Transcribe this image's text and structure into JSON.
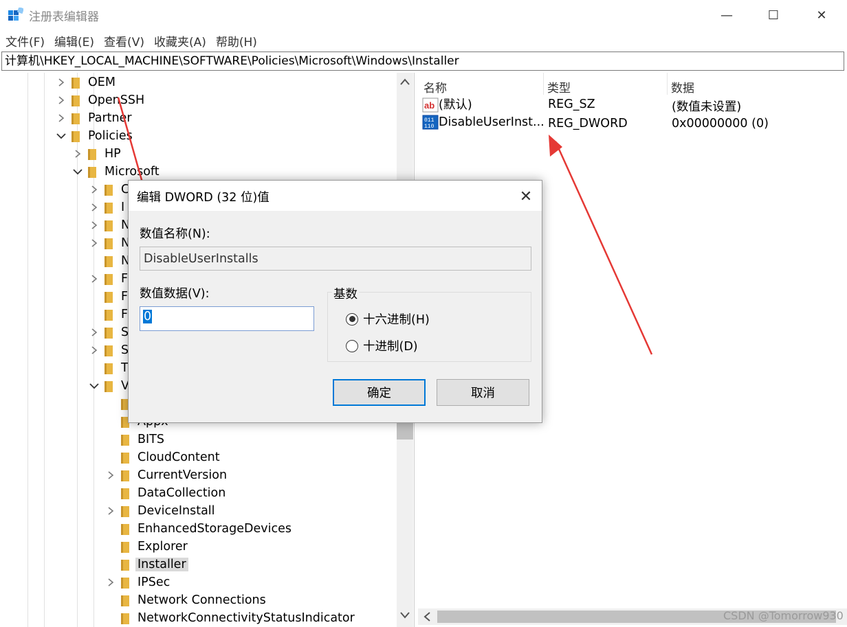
{
  "window": {
    "title": "注册表编辑器",
    "minimize_glyph": "—",
    "maximize_glyph": "☐",
    "close_glyph": "✕"
  },
  "menu": [
    "文件(F)",
    "编辑(E)",
    "查看(V)",
    "收藏夹(A)",
    "帮助(H)"
  ],
  "address": "计算机\\HKEY_LOCAL_MACHINE\\SOFTWARE\\Policies\\Microsoft\\Windows\\Installer",
  "tree": [
    {
      "label": "OEM",
      "depth": 0,
      "expander": "collapsed"
    },
    {
      "label": "OpenSSH",
      "depth": 0,
      "expander": "collapsed"
    },
    {
      "label": "Partner",
      "depth": 0,
      "expander": "collapsed"
    },
    {
      "label": "Policies",
      "depth": 0,
      "expander": "expanded"
    },
    {
      "label": "HP",
      "depth": 1,
      "expander": "collapsed"
    },
    {
      "label": "Microsoft",
      "depth": 1,
      "expander": "expanded"
    },
    {
      "label": "C",
      "depth": 2,
      "expander": "collapsed"
    },
    {
      "label": "I",
      "depth": 2,
      "expander": "collapsed"
    },
    {
      "label": "N",
      "depth": 2,
      "expander": "collapsed"
    },
    {
      "label": "N",
      "depth": 2,
      "expander": "collapsed"
    },
    {
      "label": "N",
      "depth": 2,
      "expander": "none"
    },
    {
      "label": "F",
      "depth": 2,
      "expander": "collapsed"
    },
    {
      "label": "F",
      "depth": 2,
      "expander": "none"
    },
    {
      "label": "F",
      "depth": 2,
      "expander": "none"
    },
    {
      "label": "S",
      "depth": 2,
      "expander": "collapsed"
    },
    {
      "label": "S",
      "depth": 2,
      "expander": "collapsed"
    },
    {
      "label": "T",
      "depth": 2,
      "expander": "none"
    },
    {
      "label": "V",
      "depth": 2,
      "expander": "expanded"
    },
    {
      "label": "",
      "depth": 3,
      "expander": "none"
    },
    {
      "label": "Appx",
      "depth": 3,
      "expander": "none"
    },
    {
      "label": "BITS",
      "depth": 3,
      "expander": "none"
    },
    {
      "label": "CloudContent",
      "depth": 3,
      "expander": "none"
    },
    {
      "label": "CurrentVersion",
      "depth": 3,
      "expander": "collapsed"
    },
    {
      "label": "DataCollection",
      "depth": 3,
      "expander": "none"
    },
    {
      "label": "DeviceInstall",
      "depth": 3,
      "expander": "collapsed"
    },
    {
      "label": "EnhancedStorageDevices",
      "depth": 3,
      "expander": "none"
    },
    {
      "label": "Explorer",
      "depth": 3,
      "expander": "none"
    },
    {
      "label": "Installer",
      "depth": 3,
      "expander": "none",
      "selected": true
    },
    {
      "label": "IPSec",
      "depth": 3,
      "expander": "collapsed"
    },
    {
      "label": "Network Connections",
      "depth": 3,
      "expander": "none"
    },
    {
      "label": "NetworkConnectivityStatusIndicator",
      "depth": 3,
      "expander": "none"
    }
  ],
  "list": {
    "headers": [
      "名称",
      "类型",
      "数据"
    ],
    "rows": [
      {
        "icon": "string-value-icon",
        "name": "(默认)",
        "type": "REG_SZ",
        "data": "(数值未设置)"
      },
      {
        "icon": "binary-value-icon",
        "name": "DisableUserInst...",
        "type": "REG_DWORD",
        "data": "0x00000000 (0)"
      }
    ]
  },
  "dialog": {
    "title": "编辑 DWORD (32 位)值",
    "name_label": "数值名称(N):",
    "name_value": "DisableUserInstalls",
    "data_label": "数值数据(V):",
    "data_value": "0",
    "base_label": "基数",
    "radio_hex": "十六进制(H)",
    "radio_dec": "十进制(D)",
    "hex_selected": true,
    "ok": "确定",
    "cancel": "取消",
    "close_glyph": "✕"
  },
  "watermark": "CSDN @Tomorrow930",
  "colors": {
    "folder": "#e8b642",
    "selection": "#0078d7",
    "annotation_arrow": "#e53935"
  }
}
